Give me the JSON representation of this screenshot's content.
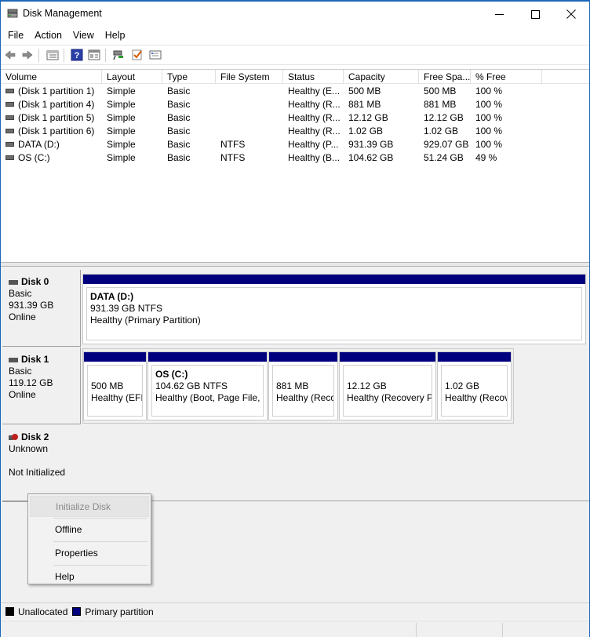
{
  "window": {
    "title": "Disk Management",
    "controls": {
      "minimize": "—",
      "maximize": "☐",
      "close": "✕"
    }
  },
  "menu": [
    "File",
    "Action",
    "View",
    "Help"
  ],
  "toolbar": {
    "icons": [
      "back-icon",
      "forward-icon",
      "disk-list-icon",
      "help-icon",
      "properties-icon",
      "connect-icon",
      "check-icon",
      "settings-icon"
    ]
  },
  "volume_table": {
    "columns": [
      "Volume",
      "Layout",
      "Type",
      "File System",
      "Status",
      "Capacity",
      "Free Spa...",
      "% Free"
    ],
    "rows": [
      [
        "(Disk 1 partition 1)",
        "Simple",
        "Basic",
        "",
        "Healthy (E...",
        "500 MB",
        "500 MB",
        "100 %"
      ],
      [
        "(Disk 1 partition 4)",
        "Simple",
        "Basic",
        "",
        "Healthy (R...",
        "881 MB",
        "881 MB",
        "100 %"
      ],
      [
        "(Disk 1 partition 5)",
        "Simple",
        "Basic",
        "",
        "Healthy (R...",
        "12.12 GB",
        "12.12 GB",
        "100 %"
      ],
      [
        "(Disk 1 partition 6)",
        "Simple",
        "Basic",
        "",
        "Healthy (R...",
        "1.02 GB",
        "1.02 GB",
        "100 %"
      ],
      [
        "DATA (D:)",
        "Simple",
        "Basic",
        "NTFS",
        "Healthy (P...",
        "931.39 GB",
        "929.07 GB",
        "100 %"
      ],
      [
        "OS (C:)",
        "Simple",
        "Basic",
        "NTFS",
        "Healthy (B...",
        "104.62 GB",
        "51.24 GB",
        "49 %"
      ]
    ]
  },
  "disks": [
    {
      "name": "Disk 0",
      "type": "Basic",
      "size": "931.39 GB",
      "status": "Online",
      "partitions": [
        {
          "name": "DATA  (D:)",
          "size": "931.39 GB NTFS",
          "status": "Healthy (Primary Partition)"
        }
      ]
    },
    {
      "name": "Disk 1",
      "type": "Basic",
      "size": "119.12 GB",
      "status": "Online",
      "partitions": [
        {
          "name": "",
          "size": "500 MB",
          "status": "Healthy (EFI"
        },
        {
          "name": "OS  (C:)",
          "size": "104.62 GB NTFS",
          "status": "Healthy (Boot, Page File, C"
        },
        {
          "name": "",
          "size": "881 MB",
          "status": "Healthy (Reco"
        },
        {
          "name": "",
          "size": "12.12 GB",
          "status": "Healthy (Recovery Pa"
        },
        {
          "name": "",
          "size": "1.02 GB",
          "status": "Healthy (Recov"
        }
      ]
    },
    {
      "name": "Disk 2",
      "type": "Unknown",
      "size": "",
      "status": "Not Initialized",
      "partitions": []
    }
  ],
  "context_menu": {
    "items": [
      "Initialize Disk",
      "Offline",
      "Properties",
      "Help"
    ],
    "disabled": [
      "Initialize Disk"
    ]
  },
  "legend": [
    {
      "label": "Unallocated",
      "color": "#000000"
    },
    {
      "label": "Primary partition",
      "color": "#00007f"
    }
  ]
}
